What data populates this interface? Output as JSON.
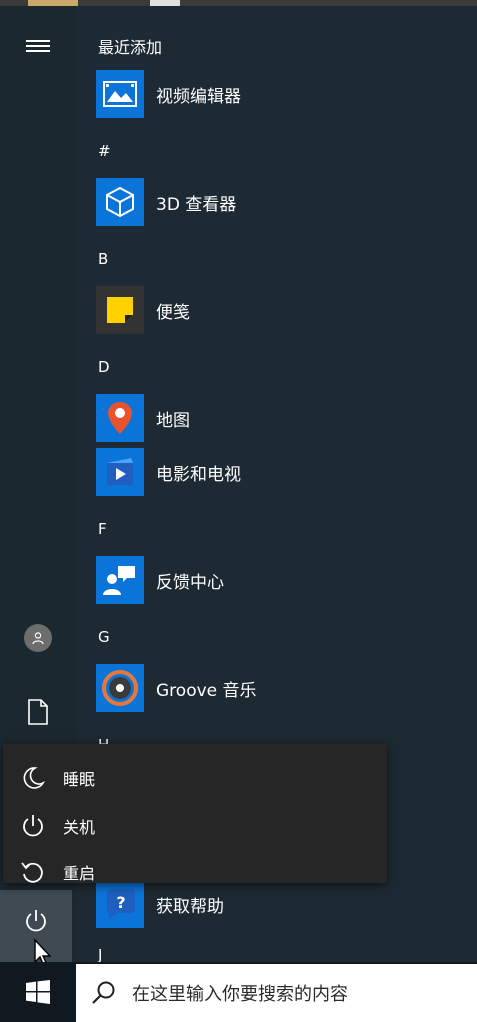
{
  "left_rail": {
    "menu_icon": "hamburger-icon",
    "user_icon": "avatar-icon",
    "documents_icon": "document-icon",
    "power_icon": "power-icon"
  },
  "app_list": {
    "recent_header": "最近添加",
    "sections": [
      {
        "letter": "#"
      },
      {
        "letter": "B"
      },
      {
        "letter": "D"
      },
      {
        "letter": "F"
      },
      {
        "letter": "G"
      },
      {
        "letter": "H"
      },
      {
        "letter": "J"
      }
    ],
    "apps": [
      {
        "label": "视频编辑器",
        "icon": "video-editor-icon",
        "tile_color": "#0a74d8"
      },
      {
        "label": "3D 查看器",
        "icon": "cube-icon",
        "tile_color": "#0a74d8"
      },
      {
        "label": "便笺",
        "icon": "sticky-notes-icon",
        "tile_color": "#333333"
      },
      {
        "label": "地图",
        "icon": "map-pin-icon",
        "tile_color": "#0a74d8"
      },
      {
        "label": "电影和电视",
        "icon": "movies-tv-icon",
        "tile_color": "#0a74d8"
      },
      {
        "label": "反馈中心",
        "icon": "feedback-icon",
        "tile_color": "#0a74d8"
      },
      {
        "label": "Groove 音乐",
        "icon": "groove-music-icon",
        "tile_color": "#0a74d8"
      },
      {
        "label": "获取帮助",
        "icon": "help-icon",
        "tile_color": "#0a74d8"
      }
    ]
  },
  "power_menu": {
    "sleep": "睡眠",
    "shutdown": "关机",
    "restart": "重启"
  },
  "taskbar": {
    "start_icon": "windows-logo-icon",
    "search_placeholder": "在这里输入你要搜索的内容"
  },
  "colors": {
    "accent": "#0a74d8",
    "background": "#1e2a33",
    "menu_bg": "#262626"
  }
}
